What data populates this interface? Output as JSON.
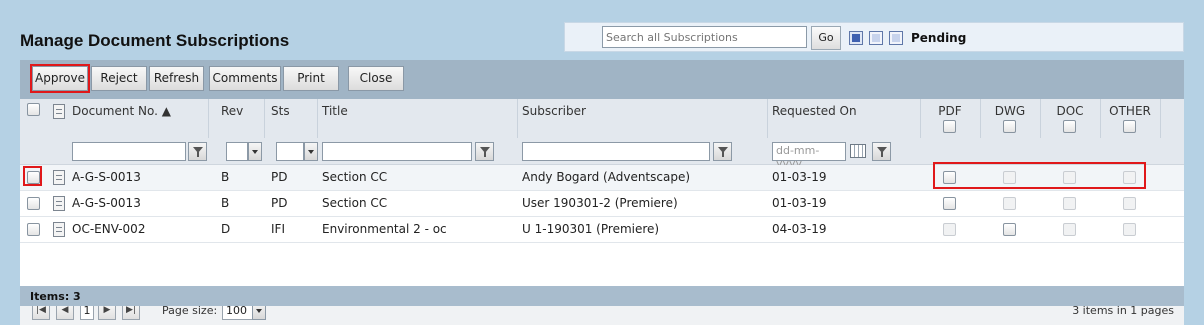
{
  "page_title": "Manage Document Subscriptions",
  "search": {
    "placeholder": "Search all Subscriptions",
    "go_label": "Go",
    "status_label": "Pending"
  },
  "toolbar": {
    "approve": "Approve",
    "reject": "Reject",
    "refresh": "Refresh",
    "comments": "Comments",
    "print": "Print",
    "close": "Close"
  },
  "columns": {
    "doc_no": "Document No. ▲",
    "rev": "Rev",
    "sts": "Sts",
    "title": "Title",
    "subscriber": "Subscriber",
    "requested_on": "Requested On",
    "pdf": "PDF",
    "dwg": "DWG",
    "doc": "DOC",
    "other": "OTHER"
  },
  "filters": {
    "date_placeholder": "dd-mm-yyyy"
  },
  "rows": [
    {
      "doc_no": "A-G-S-0013",
      "rev": "B",
      "sts": "PD",
      "title": "Section CC",
      "subscriber": "Andy Bogard (Adventscape)",
      "requested_on": "01-03-19",
      "pdf": false,
      "dwg": false,
      "doc": false,
      "other": false
    },
    {
      "doc_no": "A-G-S-0013",
      "rev": "B",
      "sts": "PD",
      "title": "Section CC",
      "subscriber": "User 190301-2 (Premiere)",
      "requested_on": "01-03-19",
      "pdf": false,
      "dwg": false,
      "doc": false,
      "other": false
    },
    {
      "doc_no": "OC-ENV-002",
      "rev": "D",
      "sts": "IFI",
      "title": "Environmental 2 - oc",
      "subscriber": "U 1-190301 (Premiere)",
      "requested_on": "04-03-19",
      "pdf": false,
      "dwg": false,
      "doc": false,
      "other": false
    }
  ],
  "pager": {
    "current_page": "1",
    "page_size_label": "Page size:",
    "page_size": "100",
    "summary": "3 items in 1 pages"
  },
  "footer": {
    "items_label": "Items: 3"
  },
  "colors": {
    "background": "#b5d1e4",
    "highlight": "#e0181a"
  }
}
